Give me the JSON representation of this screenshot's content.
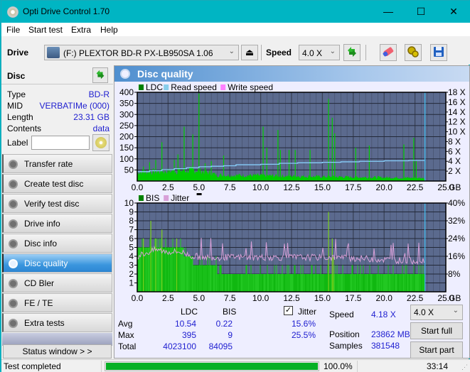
{
  "window": {
    "title": "Opti Drive Control 1.70",
    "minimize": "—",
    "maximize": "☐",
    "close": "✕"
  },
  "menu": [
    "File",
    "Start test",
    "Extra",
    "Help"
  ],
  "toolbar": {
    "drive_label": "Drive",
    "drive_value": "(F:)  PLEXTOR BD-R  PX-LB950SA 1.06",
    "eject_glyph": "⏏",
    "speed_label": "Speed",
    "speed_value": "4.0 X",
    "chevron": "⌄"
  },
  "disc": {
    "header": "Disc",
    "props": [
      {
        "key": "Type",
        "value": "BD-R"
      },
      {
        "key": "MID",
        "value": "VERBATIMe (000)"
      },
      {
        "key": "Length",
        "value": "23.31 GB"
      },
      {
        "key": "Contents",
        "value": "data"
      }
    ],
    "label_key": "Label",
    "label_value": ""
  },
  "nav": [
    {
      "label": "Transfer rate",
      "active": false
    },
    {
      "label": "Create test disc",
      "active": false
    },
    {
      "label": "Verify test disc",
      "active": false
    },
    {
      "label": "Drive info",
      "active": false
    },
    {
      "label": "Disc info",
      "active": false
    },
    {
      "label": "Disc quality",
      "active": true
    },
    {
      "label": "CD Bler",
      "active": false
    },
    {
      "label": "FE / TE",
      "active": false
    },
    {
      "label": "Extra tests",
      "active": false
    }
  ],
  "status_window_button": "Status window > >",
  "panel": {
    "title": "Disc quality"
  },
  "chart_data": [
    {
      "type": "bar",
      "title": "LDC / Read speed",
      "legend": [
        {
          "name": "LDC",
          "color": "#008000"
        },
        {
          "name": "Read speed",
          "color": "#87ceeb"
        },
        {
          "name": "Write speed",
          "color": "#ff80ff"
        }
      ],
      "legend_position": "top-left",
      "xlabel": "GB",
      "xlim": [
        0,
        25
      ],
      "x_ticks": [
        "0.0",
        "2.5",
        "5.0",
        "7.5",
        "10.0",
        "12.5",
        "15.0",
        "17.5",
        "20.0",
        "22.5",
        "25.0"
      ],
      "ylim": [
        0,
        400
      ],
      "y_ticks": [
        "50",
        "100",
        "150",
        "200",
        "250",
        "300",
        "350",
        "400"
      ],
      "y2lim": [
        0,
        18
      ],
      "y2_ticks": [
        "2 X",
        "4 X",
        "6 X",
        "8 X",
        "10 X",
        "12 X",
        "14 X",
        "16 X",
        "18 X"
      ],
      "grid": true,
      "end_marker_gb": 23.31,
      "ldc_baseline": [
        [
          0,
          45
        ],
        [
          2.5,
          50
        ],
        [
          5,
          55
        ],
        [
          6.5,
          30
        ],
        [
          10,
          28
        ],
        [
          15,
          22
        ],
        [
          20,
          18
        ],
        [
          23.3,
          15
        ]
      ],
      "ldc_spikes": [
        [
          0.5,
          65
        ],
        [
          1,
          85
        ],
        [
          1.5,
          95
        ],
        [
          2,
          175
        ],
        [
          3,
          95
        ],
        [
          3.3,
          120
        ],
        [
          3.8,
          245
        ],
        [
          4.5,
          210
        ],
        [
          5.0,
          395
        ],
        [
          5.5,
          80
        ],
        [
          6,
          90
        ],
        [
          7,
          115
        ],
        [
          10.2,
          245
        ],
        [
          10.5,
          150
        ],
        [
          11.4,
          230
        ],
        [
          11.6,
          140
        ],
        [
          12.3,
          140
        ],
        [
          12.8,
          140
        ],
        [
          14.0,
          140
        ],
        [
          15.5,
          370
        ],
        [
          15.8,
          285
        ],
        [
          16.0,
          215
        ],
        [
          17.7,
          150
        ],
        [
          18.8,
          160
        ],
        [
          21.6,
          165
        ],
        [
          22.4,
          195
        ],
        [
          22.6,
          90
        ]
      ],
      "read_speed_x": [
        [
          0,
          1.9
        ],
        [
          1.0,
          2.1
        ],
        [
          2.0,
          2.3
        ],
        [
          3.0,
          2.5
        ],
        [
          4.0,
          2.7
        ],
        [
          5.0,
          2.9
        ],
        [
          6.0,
          3.0
        ],
        [
          7.0,
          3.1
        ],
        [
          8.0,
          3.3
        ],
        [
          10.0,
          3.4
        ],
        [
          11.5,
          3.6
        ],
        [
          13.0,
          3.7
        ],
        [
          15.0,
          3.8
        ],
        [
          16.5,
          3.9
        ],
        [
          18.0,
          4.0
        ],
        [
          20.0,
          4.1
        ],
        [
          22.0,
          4.18
        ],
        [
          23.31,
          4.18
        ]
      ]
    },
    {
      "type": "bar",
      "title": "BIS / Jitter",
      "legend": [
        {
          "name": "BIS",
          "color": "#008000"
        },
        {
          "name": "Jitter",
          "color": "#d8a0d8"
        }
      ],
      "legend_position": "top-left",
      "xlabel": "GB",
      "xlim": [
        0,
        25
      ],
      "x_ticks": [
        "0.0",
        "2.5",
        "5.0",
        "7.5",
        "10.0",
        "12.5",
        "15.0",
        "17.5",
        "20.0",
        "22.5",
        "25.0"
      ],
      "ylim": [
        0,
        10
      ],
      "y_ticks": [
        "1",
        "2",
        "3",
        "4",
        "5",
        "6",
        "7",
        "8",
        "9",
        "10"
      ],
      "y2lim": [
        0,
        40
      ],
      "y2_ticks": [
        "8%",
        "16%",
        "24%",
        "32%",
        "40%"
      ],
      "grid": true,
      "end_marker_gb": 23.31,
      "bis_levels": [
        [
          0,
          5
        ],
        [
          3.8,
          4
        ],
        [
          4.5,
          3
        ],
        [
          6.5,
          2
        ],
        [
          23.31,
          2
        ]
      ],
      "bis_spikes": [
        [
          1.1,
          8
        ],
        [
          2.0,
          7
        ],
        [
          0.5,
          6
        ],
        [
          1.5,
          6
        ],
        [
          3.2,
          6
        ],
        [
          15.5,
          9
        ],
        [
          15.8,
          6
        ],
        [
          15.9,
          4
        ]
      ],
      "jitter_pct": [
        [
          0,
          16
        ],
        [
          0.5,
          17
        ],
        [
          1.0,
          18
        ],
        [
          1.5,
          19
        ],
        [
          2.5,
          18
        ],
        [
          3.5,
          18
        ],
        [
          4.5,
          16
        ],
        [
          6.0,
          15.5
        ],
        [
          8.0,
          15.5
        ],
        [
          10.0,
          15.5
        ],
        [
          12.0,
          15.5
        ],
        [
          14.0,
          15.5
        ],
        [
          16.0,
          15.5
        ],
        [
          18.0,
          15
        ],
        [
          20.0,
          14.5
        ],
        [
          22.0,
          14
        ],
        [
          23.31,
          14
        ]
      ]
    }
  ],
  "stats": {
    "col_ldc": "LDC",
    "col_bis": "BIS",
    "jitter_label": "Jitter",
    "jitter_checked": true,
    "rows": [
      {
        "label": "Avg",
        "ldc": "10.54",
        "bis": "0.22",
        "jitter": "15.6%"
      },
      {
        "label": "Max",
        "ldc": "395",
        "bis": "9",
        "jitter": "25.5%"
      },
      {
        "label": "Total",
        "ldc": "4023100",
        "bis": "84095",
        "jitter": ""
      }
    ],
    "speed_label": "Speed",
    "speed_value": "4.18 X",
    "position_label": "Position",
    "position_value": "23862 MB",
    "samples_label": "Samples",
    "samples_value": "381548",
    "speed_select": "4.0 X",
    "start_full": "Start full",
    "start_part": "Start part"
  },
  "statusbar": {
    "text": "Test completed",
    "progress_pct": 100.0,
    "progress_text": "100.0%",
    "time": "33:14"
  },
  "colors": {
    "titlebar": "#00b5c3",
    "plot_bg": "#5b6a8e",
    "ldc": "#00cc00",
    "read_speed": "#87cefa",
    "jitter": "#d8a0d8",
    "marker": "#40c0f0",
    "progress": "#06b025"
  }
}
